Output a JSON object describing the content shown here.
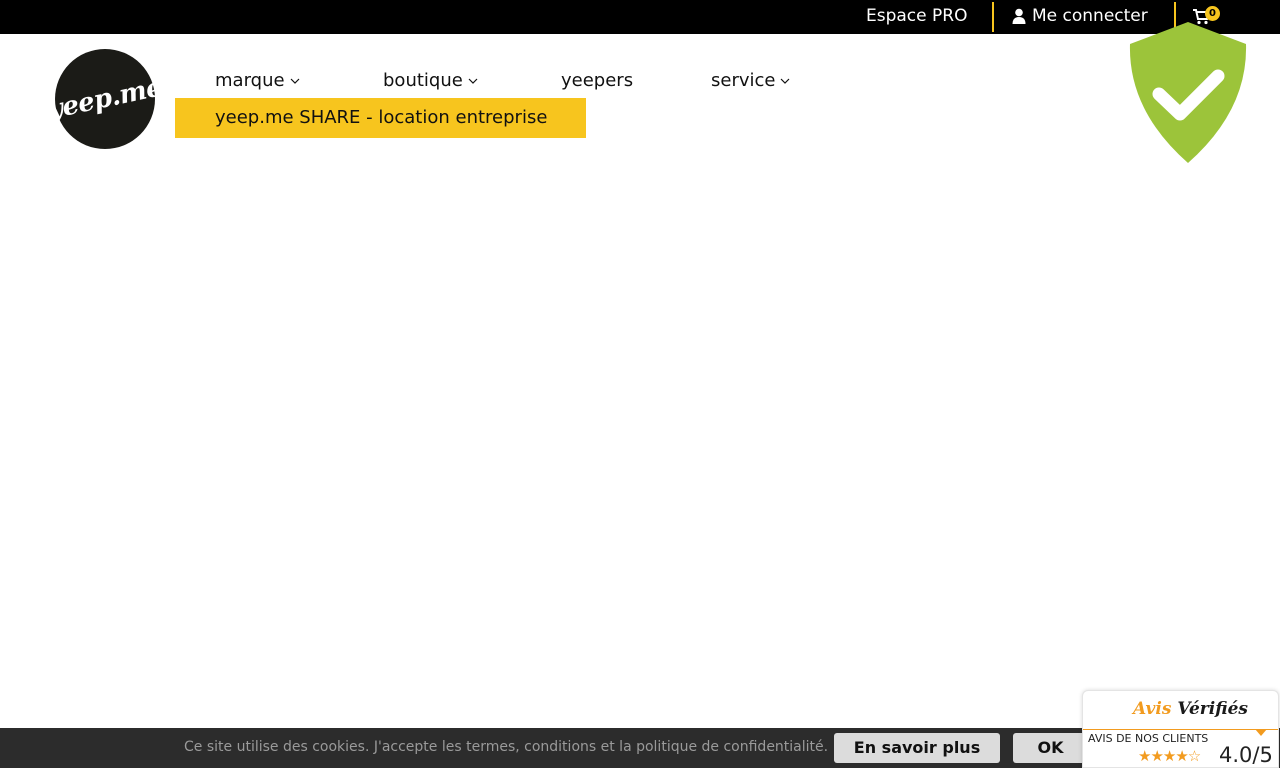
{
  "topbar": {
    "espace_pro": "Espace PRO",
    "login": "Me connecter",
    "cart_count": "0",
    "accent_color": "#f7c51e"
  },
  "logo": {
    "text": "yeep.me"
  },
  "nav": {
    "marque": "marque",
    "boutique": "boutique",
    "yeepers": "yeepers",
    "service": "service"
  },
  "dropdown": {
    "item": "yeep.me SHARE - location entreprise"
  },
  "shield": {
    "icon": "check-shield-icon",
    "color": "#9cc43a"
  },
  "cookie": {
    "message": "Ce site utilise des cookies. J'accepte les termes, conditions et la politique de confidentialité.",
    "more": "En savoir plus",
    "ok": "OK"
  },
  "avis": {
    "brand_part1": "Avis",
    "brand_part2": "Vérifiés",
    "subtitle": "AVIS DE NOS CLIENTS",
    "stars_full": "★★★★",
    "stars_empty": "☆",
    "rating": 4.0,
    "score": "4.0/5"
  }
}
